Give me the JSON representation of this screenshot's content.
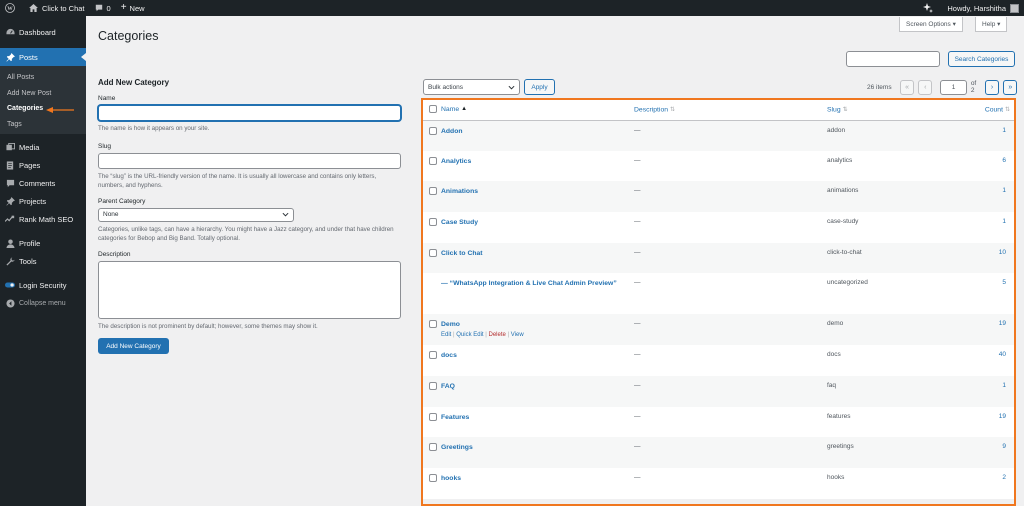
{
  "adminbar": {
    "site_name": "Click to Chat",
    "comments_count": "0",
    "new_label": "New",
    "howdy": "Howdy, Harshitha"
  },
  "sidebar": {
    "items": [
      {
        "label": "Dashboard",
        "icon": "dashboard-icon"
      },
      {
        "label": "Posts",
        "icon": "pushpin-icon",
        "active": true
      },
      {
        "label": "Media",
        "icon": "media-icon"
      },
      {
        "label": "Pages",
        "icon": "pages-icon"
      },
      {
        "label": "Comments",
        "icon": "comments-icon"
      },
      {
        "label": "Projects",
        "icon": "pushpin-icon"
      },
      {
        "label": "Rank Math SEO",
        "icon": "rank-math-icon"
      },
      {
        "label": "Profile",
        "icon": "user-icon"
      },
      {
        "label": "Tools",
        "icon": "wrench-icon"
      },
      {
        "label": "Login Security",
        "icon": "shield-icon"
      },
      {
        "label": "Collapse menu",
        "icon": "collapse-icon"
      }
    ],
    "posts_submenu": [
      "All Posts",
      "Add New Post",
      "Categories",
      "Tags"
    ]
  },
  "header": {
    "title": "Categories",
    "screen_options": "Screen Options ▾",
    "help": "Help ▾",
    "search_button": "Search Categories",
    "search_placeholder": ""
  },
  "form": {
    "heading": "Add New Category",
    "name_label": "Name",
    "name_help": "The name is how it appears on your site.",
    "slug_label": "Slug",
    "slug_help": "The “slug” is the URL-friendly version of the name. It is usually all lowercase and contains only letters, numbers, and hyphens.",
    "parent_label": "Parent Category",
    "parent_value": "None",
    "parent_help": "Categories, unlike tags, can have a hierarchy. You might have a Jazz category, and under that have children categories for Bebop and Big Band. Totally optional.",
    "description_label": "Description",
    "description_help": "The description is not prominent by default; however, some themes may show it.",
    "submit": "Add New Category"
  },
  "tablenav": {
    "bulk_actions": "Bulk actions",
    "apply": "Apply",
    "items_count": "26 items",
    "first": "«",
    "prev": "‹",
    "current_page": "1",
    "of_pages": "of 2",
    "next": "›",
    "last": "»"
  },
  "table": {
    "columns": {
      "name": "Name",
      "description": "Description",
      "slug": "Slug",
      "count": "Count"
    },
    "row_actions": {
      "edit": "Edit",
      "quick_edit": "Quick Edit",
      "delete": "Delete",
      "view": "View"
    },
    "rows": [
      {
        "name": "Addon",
        "description": "—",
        "slug": "addon",
        "count": "1"
      },
      {
        "name": "Analytics",
        "description": "—",
        "slug": "analytics",
        "count": "6"
      },
      {
        "name": "Animations",
        "description": "—",
        "slug": "animations",
        "count": "1"
      },
      {
        "name": "Case Study",
        "description": "—",
        "slug": "case-study",
        "count": "1"
      },
      {
        "name": "Click to Chat",
        "description": "—",
        "slug": "click-to-chat",
        "count": "10"
      },
      {
        "name": "— “WhatsApp Integration & Live Chat Admin Preview”",
        "description": "—",
        "slug": "uncategorized",
        "count": "5"
      },
      {
        "name": "Demo",
        "description": "—",
        "slug": "demo",
        "count": "19"
      },
      {
        "name": "docs",
        "description": "—",
        "slug": "docs",
        "count": "40"
      },
      {
        "name": "FAQ",
        "description": "—",
        "slug": "faq",
        "count": "1"
      },
      {
        "name": "Features",
        "description": "—",
        "slug": "features",
        "count": "19"
      },
      {
        "name": "Greetings",
        "description": "—",
        "slug": "greetings",
        "count": "9"
      },
      {
        "name": "hooks",
        "description": "—",
        "slug": "hooks",
        "count": "2"
      }
    ]
  },
  "colors": {
    "admin_dark": "#1d2327",
    "accent": "#2271b1",
    "highlight_border": "#f0771f",
    "delete_red": "#b32d2e"
  }
}
